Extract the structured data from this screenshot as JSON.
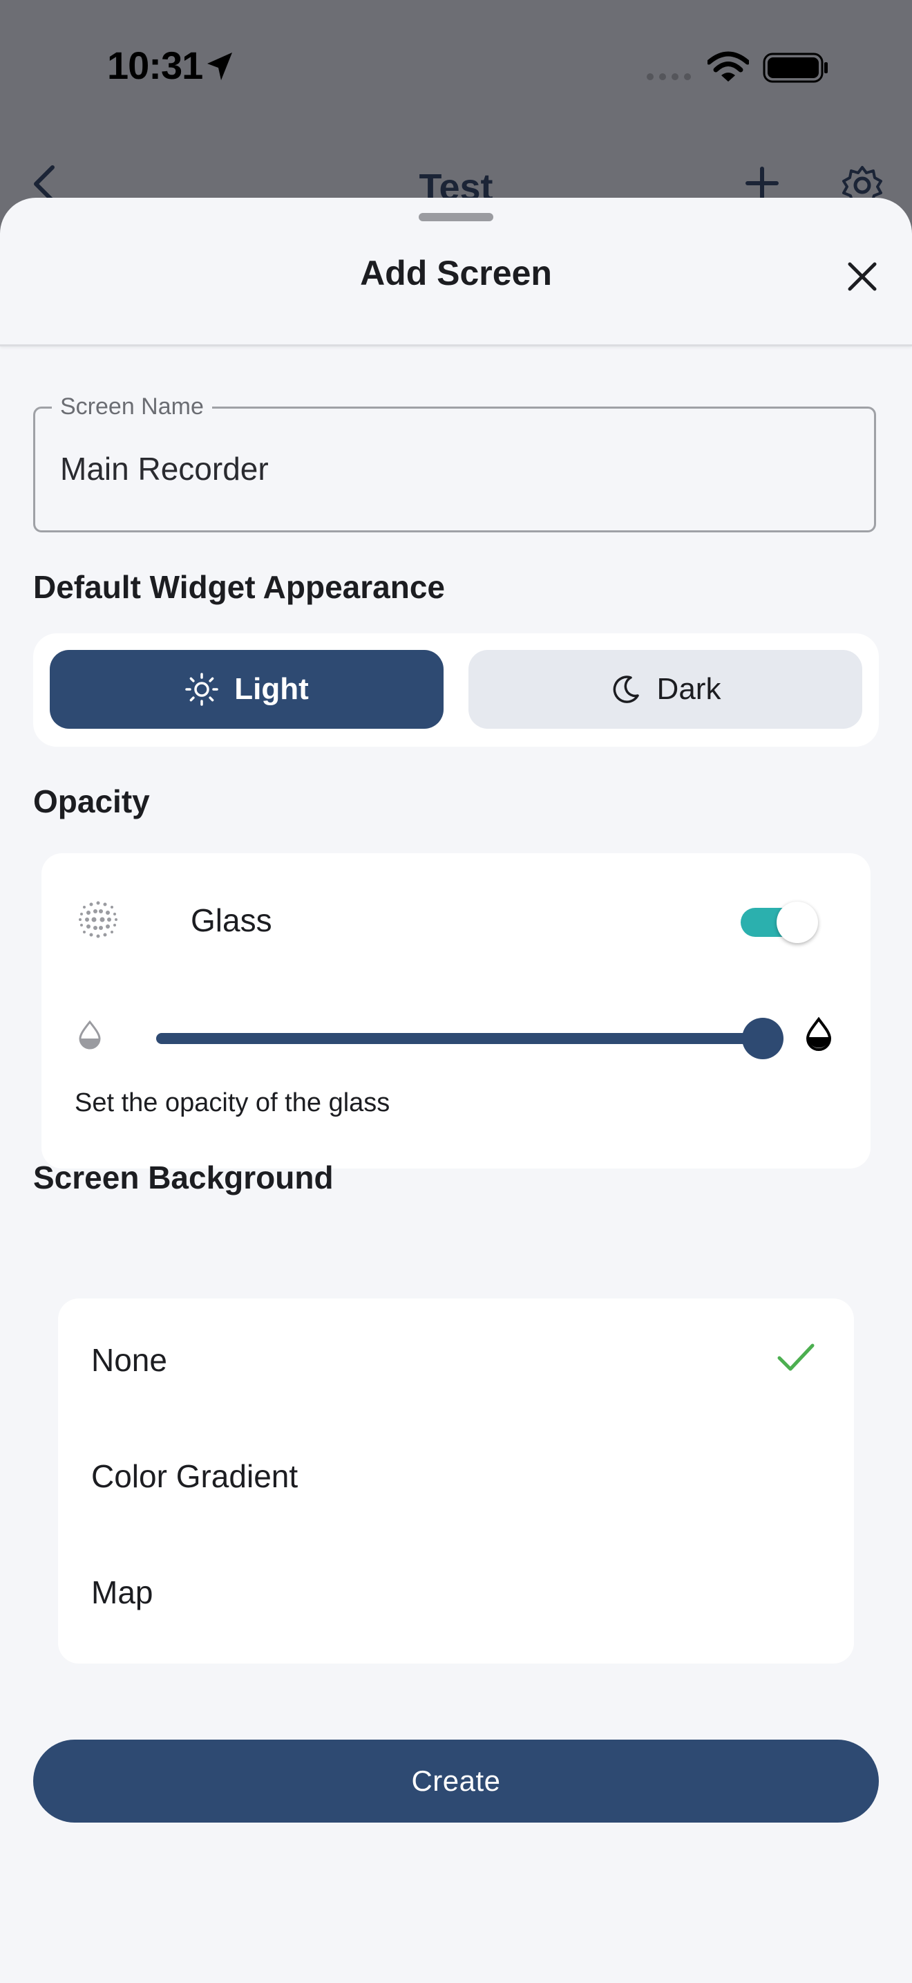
{
  "status_bar": {
    "time": "10:31"
  },
  "background_page": {
    "title": "Test"
  },
  "sheet": {
    "title": "Add Screen"
  },
  "screen_name": {
    "label": "Screen Name",
    "value": "Main Recorder"
  },
  "appearance": {
    "heading": "Default Widget Appearance",
    "options": [
      {
        "label": "Light",
        "icon": "sun-icon",
        "selected": true
      },
      {
        "label": "Dark",
        "icon": "moon-icon",
        "selected": false
      }
    ]
  },
  "opacity": {
    "heading": "Opacity",
    "glass_label": "Glass",
    "glass_enabled": true,
    "slider_value": 1.0,
    "help_text": "Set the opacity of the glass"
  },
  "background": {
    "heading": "Screen Background",
    "items": [
      {
        "label": "None",
        "selected": true
      },
      {
        "label": "Color Gradient",
        "selected": false
      },
      {
        "label": "Map",
        "selected": false
      }
    ]
  },
  "create_label": "Create",
  "colors": {
    "accent": "#2e4a72",
    "toggle_on": "#2bb0ae",
    "check": "#4caf50",
    "sheet_background": "#f5f6f9"
  }
}
